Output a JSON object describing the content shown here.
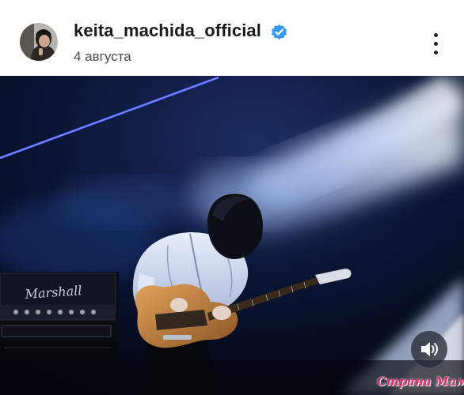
{
  "post": {
    "username": "keita_machida_official",
    "verified": true,
    "date": "4 августа",
    "avatar_icon": "user-avatar-photo",
    "menu_icon": "more-vertical-icon"
  },
  "media": {
    "type": "video",
    "amp_brand": "Marshall",
    "sound_icon": "speaker-volume-icon"
  },
  "watermark": {
    "text": "Страна Мам"
  },
  "colors": {
    "verified_blue": "#3897f0",
    "stage_dark": "#040817",
    "stage_light": "#cfe2ff",
    "watermark": "#d82f67"
  }
}
